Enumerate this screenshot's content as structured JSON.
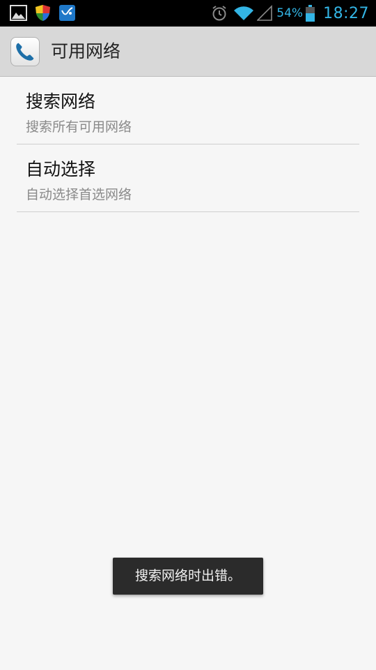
{
  "status_bar": {
    "notification_icons": [
      "gallery-icon",
      "shield-icon",
      "fliq-icon"
    ],
    "alarm_icon": "alarm-icon",
    "wifi_icon": "wifi-icon",
    "signal_icon": "signal-icon",
    "battery_percent": "54%",
    "battery_icon": "battery-icon",
    "time": "18:27",
    "accent_color": "#33b5e5"
  },
  "action_bar": {
    "icon": "phone-icon",
    "title": "可用网络"
  },
  "preferences": [
    {
      "title": "搜索网络",
      "summary": "搜索所有可用网络"
    },
    {
      "title": "自动选择",
      "summary": "自动选择首选网络"
    }
  ],
  "toast": {
    "text": "搜索网络时出错。"
  }
}
